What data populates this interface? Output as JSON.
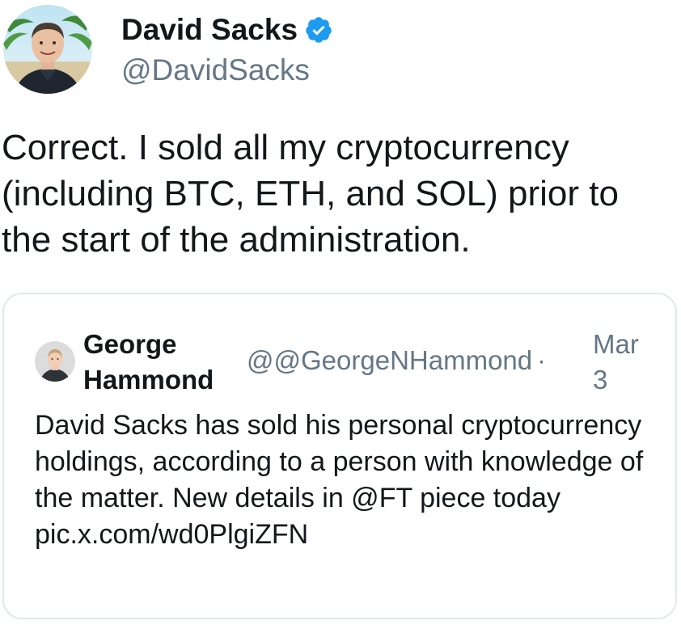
{
  "tweet": {
    "author": {
      "name": "David Sacks",
      "handle": "@DavidSacks",
      "verified": true,
      "avatar_icon": "profile-photo-david-sacks"
    },
    "text": "Correct. I sold all my cryptocurrency (including BTC, ETH, and SOL) prior to the start of the administration."
  },
  "quoted_tweet": {
    "author": {
      "name": "George Hammond",
      "handle_prefix": "@",
      "handle": "@GeorgeNHammond",
      "separator": "·",
      "avatar_icon": "profile-photo-george-hammond"
    },
    "date": "Mar 3",
    "text": "David Sacks has sold his personal cryptocurrency holdings, according to a person with knowledge of the matter. New details in @FT piece today",
    "link": "pic.x.com/wd0PlgiZFN"
  },
  "colors": {
    "text_primary": "#14171a",
    "text_secondary": "#657786",
    "verified_blue": "#1d9bf0",
    "card_border": "#e1e8ed"
  }
}
